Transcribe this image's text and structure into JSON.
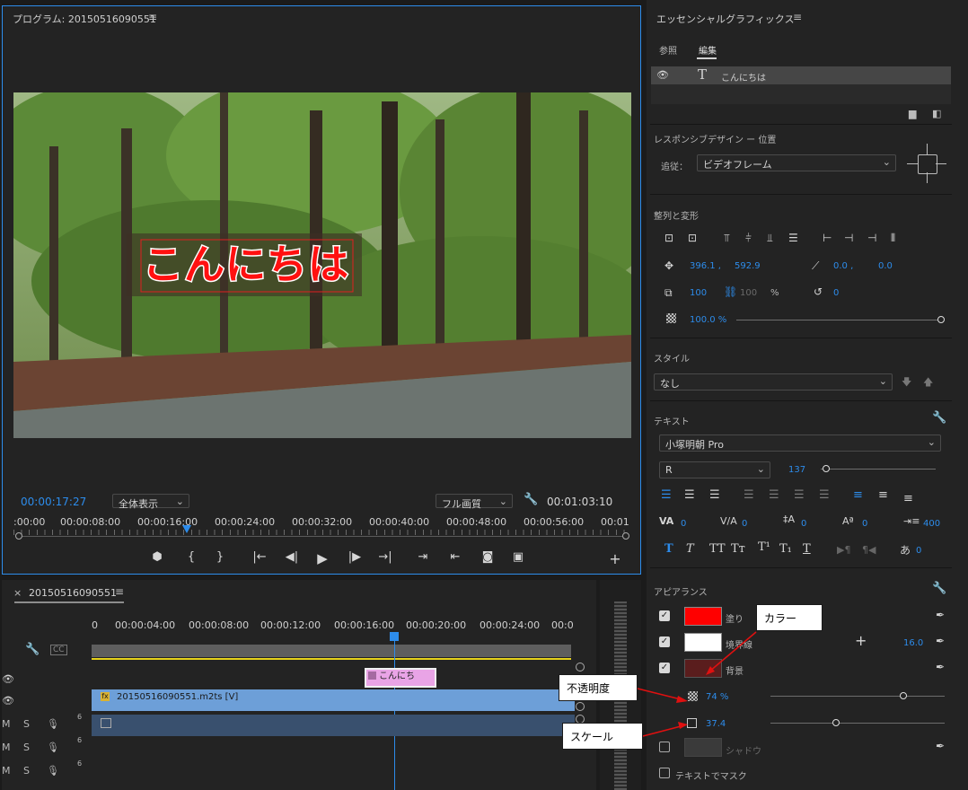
{
  "program": {
    "title": "プログラム: 20150516090551",
    "menu_icon": "hamburger-icon",
    "overlay_text": "こんにちは",
    "current_time": "00:00:17:27",
    "zoom_select": "全体表示",
    "quality_select": "フル画質",
    "duration": "00:01:03:10",
    "ruler_labels": [
      ":00:00",
      "00:00:08:00",
      "00:00:16:00",
      "00:00:24:00",
      "00:00:32:00",
      "00:00:40:00",
      "00:00:48:00",
      "00:00:56:00",
      "00:01"
    ],
    "controls": [
      "marker-icon",
      "mark-in-icon",
      "mark-out-icon",
      "go-to-in-icon",
      "step-back-icon",
      "play-icon",
      "step-forward-icon",
      "go-to-out-icon",
      "lift-icon",
      "extract-icon",
      "camera-icon",
      "compare-icon",
      "add-icon"
    ],
    "controls_glyphs": [
      "⬢",
      "{",
      "}",
      "|←",
      "◀|",
      "▶",
      "|▶",
      "→|",
      "⇥",
      "⇤",
      "◙",
      "▣",
      "+"
    ]
  },
  "timeline": {
    "close_label": "×",
    "sequence_name": "20150516090551",
    "ruler_labels": [
      "0",
      "00:00:04:00",
      "00:00:08:00",
      "00:00:12:00",
      "00:00:16:00",
      "00:00:20:00",
      "00:00:24:00",
      "00:0"
    ],
    "graphic_clip_label": "こんにち",
    "video_clip_label": "20150516090551.m2ts [V]",
    "track_m": "M",
    "track_s": "S",
    "track_num": "6"
  },
  "eg": {
    "title": "エッセンシャルグラフィックス",
    "tabs": [
      "参照",
      "編集"
    ],
    "layer_name": "こんにちは",
    "responsive_title": "レスポンシブデザイン ー 位置",
    "follow_label": "追従：",
    "follow_value": "ビデオフレーム",
    "align_title": "整列と変形",
    "pos_x": "396.1 ,",
    "pos_y": "592.9",
    "anchor_x": "0.0 ,",
    "anchor_y": "0.0",
    "scale_val": "100",
    "scale_linked": "100",
    "percent": "%",
    "rotation": "0",
    "opacity": "100.0 %",
    "style_title": "スタイル",
    "style_value": "なし",
    "text_title": "テキスト",
    "font_name": "小塚明朝 Pro",
    "font_style": "R",
    "font_size": "137",
    "tracking_values": [
      "0",
      "0",
      "0",
      "0",
      "400"
    ],
    "tsume_values": [
      "0",
      "0"
    ],
    "appearance_title": "アピアランス",
    "fill_label": "塗り",
    "stroke_label": "境界線",
    "stroke_width": "16.0",
    "bg_label": "背景",
    "bg_opacity": "74 %",
    "bg_scale": "37.4",
    "shadow_label": "シャドウ",
    "mask_label": "テキストでマスク",
    "fill_color": "#ff0000",
    "stroke_color": "#ffffff",
    "accent": "#2d8ceb"
  },
  "callouts": {
    "color": "カラー",
    "opacity": "不透明度",
    "scale": "スケール"
  }
}
